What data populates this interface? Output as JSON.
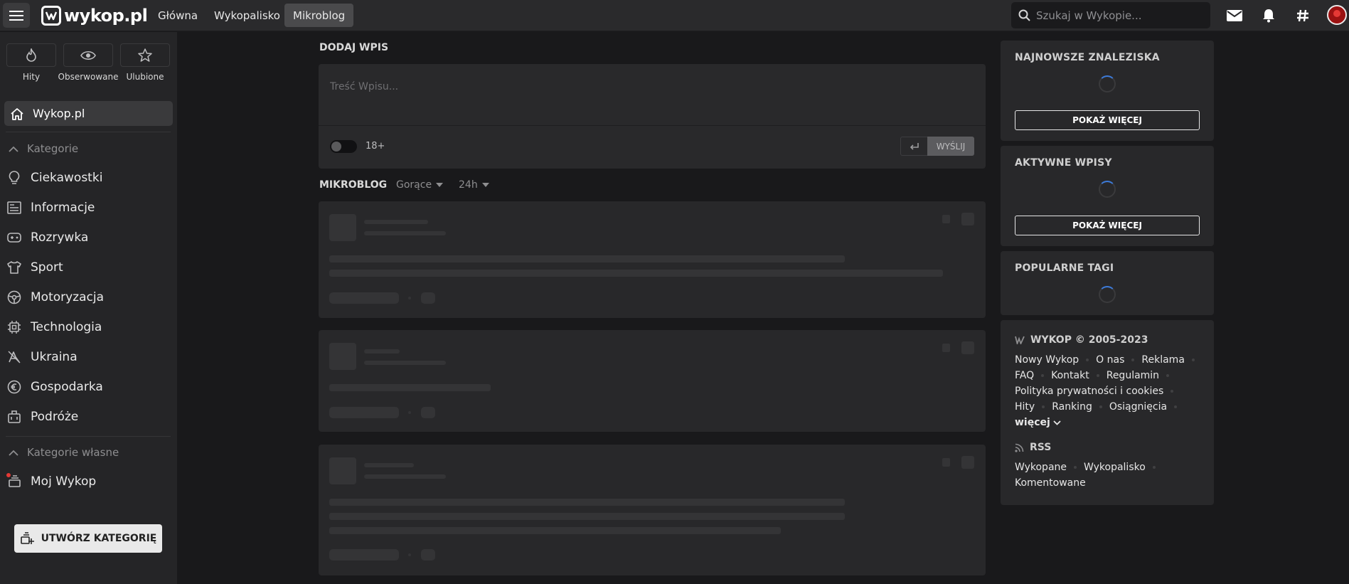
{
  "topbar": {
    "logo": "wykop.pl",
    "nav": [
      "Główna",
      "Wykopalisko",
      "Mikroblog"
    ],
    "active_nav": "Mikroblog",
    "search_placeholder": "Szukaj w Wykopie..."
  },
  "sidebar": {
    "quick": [
      "Hity",
      "Obserwowane",
      "Ulubione"
    ],
    "home": "Wykop.pl",
    "categories_header": "Kategorie",
    "categories": [
      "Ciekawostki",
      "Informacje",
      "Rozrywka",
      "Sport",
      "Motoryzacja",
      "Technologia",
      "Ukraina",
      "Gospodarka",
      "Podróże"
    ],
    "own_header": "Kategorie własne",
    "my_wykop": "Moj Wykop",
    "create_button": "UTWÓRZ KATEGORIĘ"
  },
  "add_entry": {
    "title": "DODAJ WPIS",
    "placeholder": "Treść Wpisu...",
    "adult_label": "18+",
    "send_label": "WYŚLIJ"
  },
  "mikroblog": {
    "title": "MIKROBLOG",
    "sort": "Gorące",
    "period": "24h"
  },
  "right": {
    "newest_title": "NAJNOWSZE ZNALEZISKA",
    "active_title": "AKTYWNE WPISY",
    "tags_title": "POPULARNE TAGI",
    "more_label": "POKAŻ WIĘCEJ",
    "footer_title": "WYKOP © 2005-2023",
    "footer_links": [
      [
        "Nowy Wykop",
        "O nas",
        "Reklama"
      ],
      [
        "FAQ",
        "Kontakt",
        "Regulamin"
      ],
      [
        "Polityka prywatności i cookies"
      ],
      [
        "Hity",
        "Ranking",
        "Osiągnięcia"
      ]
    ],
    "more_links": "więcej",
    "rss_title": "RSS",
    "rss_links": [
      [
        "Wykopane",
        "Wykopalisko"
      ],
      [
        "Komentowane"
      ]
    ]
  },
  "colors": {
    "background": "#19191b",
    "panel": "#28282a",
    "topbar": "#2a2a2c",
    "accent": "#3d7bd9"
  }
}
